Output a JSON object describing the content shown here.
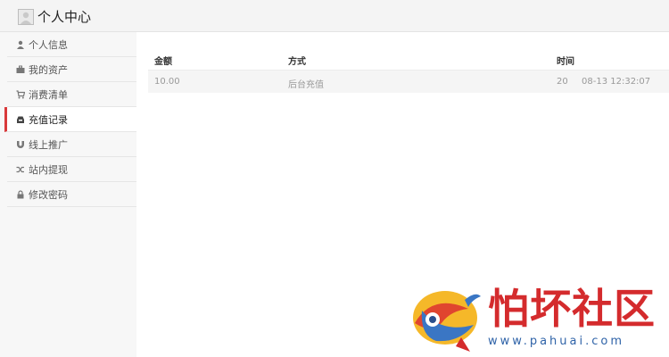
{
  "header": {
    "title": "个人中心"
  },
  "sidebar": {
    "items": [
      {
        "label": "个人信息",
        "icon": "user-icon"
      },
      {
        "label": "我的资产",
        "icon": "briefcase-icon"
      },
      {
        "label": "消费清单",
        "icon": "cart-icon"
      },
      {
        "label": "充值记录",
        "icon": "inbox-icon",
        "active": true
      },
      {
        "label": "线上推广",
        "icon": "magnet-icon"
      },
      {
        "label": "站内提现",
        "icon": "shuffle-icon"
      },
      {
        "label": "修改密码",
        "icon": "lock-icon"
      }
    ]
  },
  "table": {
    "headers": [
      "金额",
      "方式",
      "时间"
    ],
    "rows": [
      [
        "10.00",
        "后台充值",
        "20",
        "08-13 12:32:07"
      ]
    ]
  },
  "watermark": {
    "name": "怕坏社区",
    "url": "www.pahuai.com"
  },
  "colors": {
    "accent": "#d9393b",
    "watermark_red": "#d42b2d",
    "watermark_blue": "#2f63a8"
  }
}
